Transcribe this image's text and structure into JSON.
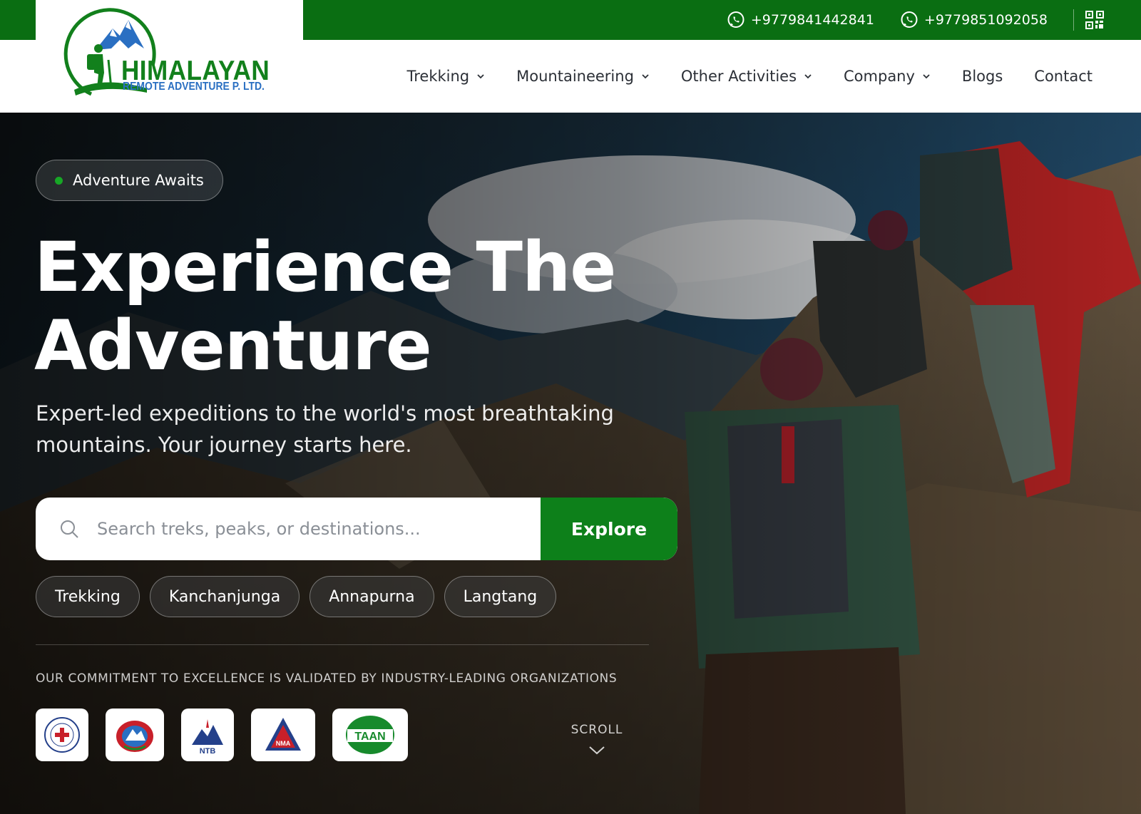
{
  "topbar": {
    "phone_1": "+9779841442841",
    "phone_2": "+9779851092058",
    "icons": [
      "whatsapp-icon",
      "whatsapp-icon",
      "qr-code-icon"
    ]
  },
  "logo": {
    "title": "HIMALAYAN",
    "subtitle": "REMOTE ADVENTURE P. LTD."
  },
  "nav": {
    "items": [
      {
        "label": "Trekking",
        "dropdown": true
      },
      {
        "label": "Mountaineering",
        "dropdown": true
      },
      {
        "label": "Other Activities",
        "dropdown": true
      },
      {
        "label": "Company",
        "dropdown": true
      },
      {
        "label": "Blogs",
        "dropdown": false
      },
      {
        "label": "Contact",
        "dropdown": false
      }
    ]
  },
  "hero": {
    "badge": "Adventure Awaits",
    "headline_line1": "Experience The",
    "headline_line2": "Adventure",
    "subtitle": "Expert-led expeditions to the world's most breathtaking mountains. Your journey starts here.",
    "search_placeholder": "Search treks, peaks, or destinations...",
    "explore_label": "Explore",
    "chips": [
      "Trekking",
      "Kanchanjunga",
      "Annapurna",
      "Langtang"
    ],
    "commitment_text": "OUR COMMITMENT TO EXCELLENCE IS VALIDATED BY INDUSTRY-LEADING ORGANIZATIONS",
    "org_logos": [
      "nepal-rescue-association-logo",
      "nepal-government-emblem-logo",
      "ntb-logo",
      "nma-logo",
      "taan-logo"
    ],
    "org_logo_text": {
      "ntb": "NTB",
      "nma": "NMA",
      "taan": "TAAN"
    },
    "scroll_label": "SCROLL"
  },
  "colors": {
    "brand_green": "#0a6e12",
    "button_green": "#0d801a",
    "logo_blue": "#2a6fc2"
  }
}
